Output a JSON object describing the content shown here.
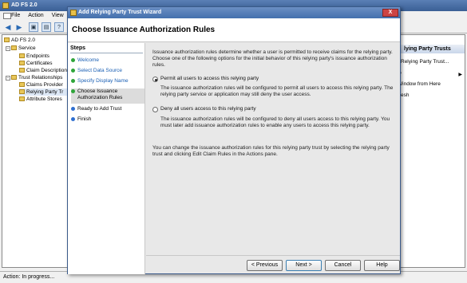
{
  "console": {
    "title": "AD FS 2.0",
    "menu": [
      "File",
      "Action",
      "View"
    ],
    "tree": [
      {
        "label": "AD FS 2.0",
        "level": 0,
        "expander": "−"
      },
      {
        "label": "Service",
        "level": 1,
        "expander": "−"
      },
      {
        "label": "Endpoints",
        "level": 2,
        "expander": ""
      },
      {
        "label": "Certificates",
        "level": 2,
        "expander": ""
      },
      {
        "label": "Claim Description",
        "level": 2,
        "expander": ""
      },
      {
        "label": "Trust Relationships",
        "level": 1,
        "expander": "−"
      },
      {
        "label": "Claims Provider",
        "level": 2,
        "expander": ""
      },
      {
        "label": "Relying Party Tr",
        "level": 2,
        "expander": ""
      },
      {
        "label": "Attribute Stores",
        "level": 2,
        "expander": ""
      }
    ],
    "actions": {
      "header": "lying Party Trusts",
      "items": [
        "Relying Party Trust...",
        "w",
        "Window from Here",
        "fresh",
        "p"
      ]
    },
    "status": "Action:  In progress..."
  },
  "wizard": {
    "title": "Add Relying Party Trust Wizard",
    "close_label": "X",
    "heading": "Choose Issuance Authorization Rules",
    "steps_title": "Steps",
    "steps": [
      {
        "label": "Welcome",
        "state": "done"
      },
      {
        "label": "Select Data Source",
        "state": "done"
      },
      {
        "label": "Specify Display Name",
        "state": "done"
      },
      {
        "label": "Choose Issuance Authorization Rules",
        "state": "current"
      },
      {
        "label": "Ready to Add Trust",
        "state": "todo"
      },
      {
        "label": "Finish",
        "state": "todo"
      }
    ],
    "intro": "Issuance authorization rules determine whether a user is permitted to receive claims for the relying party. Choose one of the following options for the initial behavior of this relying party's issuance authorization rules.",
    "option_permit": {
      "label": "Permit all users to access this relying party",
      "description": "The issuance authorization rules will be configured to permit all users to access this relying party. The relying party service or application may still deny the user access.",
      "selected": true
    },
    "option_deny": {
      "label": "Deny all users access to this relying party",
      "description": "The issuance authorization rules will be configured to deny all users access to this relying party. You must later add issuance authorization rules to enable any users to access this relying party.",
      "selected": false
    },
    "footnote": "You can change the issuance authorization rules for this relying party trust by selecting the relying party trust and clicking Edit Claim Rules in the Actions pane.",
    "buttons": {
      "previous": "< Previous",
      "next": "Next >",
      "cancel": "Cancel",
      "help": "Help"
    }
  }
}
